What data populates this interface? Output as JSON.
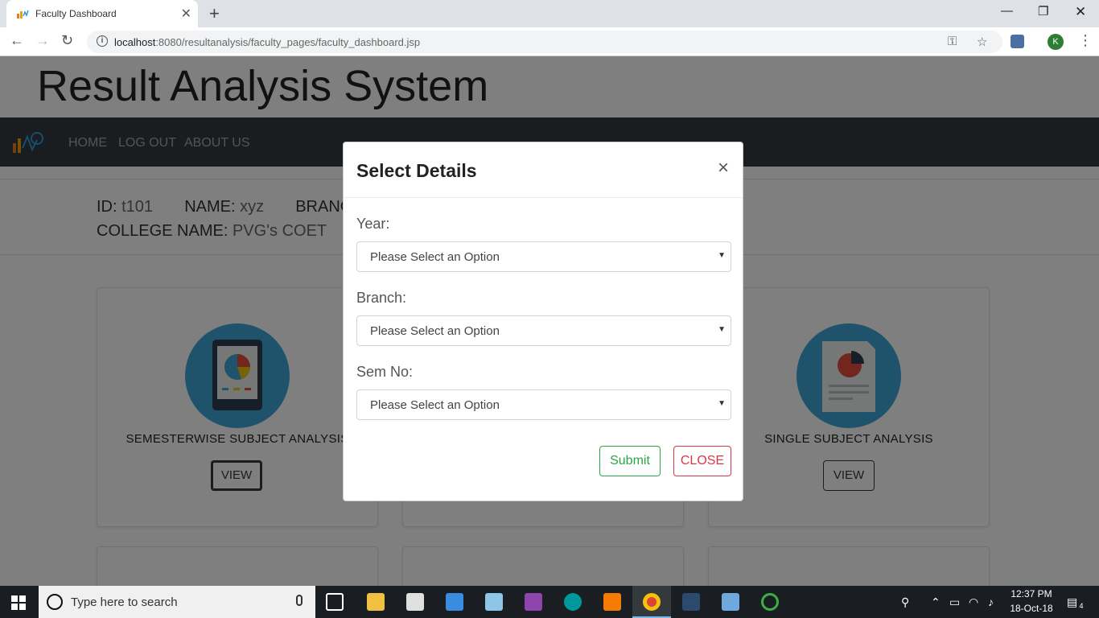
{
  "browser": {
    "tab_title": "Faculty Dashboard",
    "url_host": "localhost",
    "url_path": ":8080/resultanalysis/faculty_pages/faculty_dashboard.jsp",
    "profile_initial": "K"
  },
  "site": {
    "title": "Result Analysis System",
    "nav": [
      "HOME",
      "LOG OUT",
      "ABOUT US"
    ]
  },
  "faculty": {
    "id_label": "ID:",
    "id_value": "t101",
    "name_label": "NAME:",
    "name_value": "xyz",
    "branch_label": "BRANCH N",
    "college_label": "COLLEGE NAME:",
    "college_value": "PVG's COET"
  },
  "cards": [
    {
      "label": "SEMESTERWISE SUBJECT ANALYSIS",
      "button": "VIEW"
    },
    {
      "label": "SINGLE SUBJECT ANALYSIS",
      "button": "VIEW"
    }
  ],
  "modal": {
    "title": "Select Details",
    "close_glyph": "×",
    "fields": [
      {
        "label": "Year:",
        "value": "Please Select an Option"
      },
      {
        "label": "Branch:",
        "value": "Please Select an Option"
      },
      {
        "label": "Sem No:",
        "value": "Please Select an Option"
      }
    ],
    "submit": "Submit",
    "close": "CLOSE"
  },
  "taskbar": {
    "search_placeholder": "Type here to search",
    "time": "12:37 PM",
    "date": "18-Oct-18",
    "notifications": "4"
  },
  "colors": {
    "navbar": "#343a40",
    "card_circle": "#3fa4d6",
    "submit": "#28a745",
    "close": "#dc3545"
  }
}
